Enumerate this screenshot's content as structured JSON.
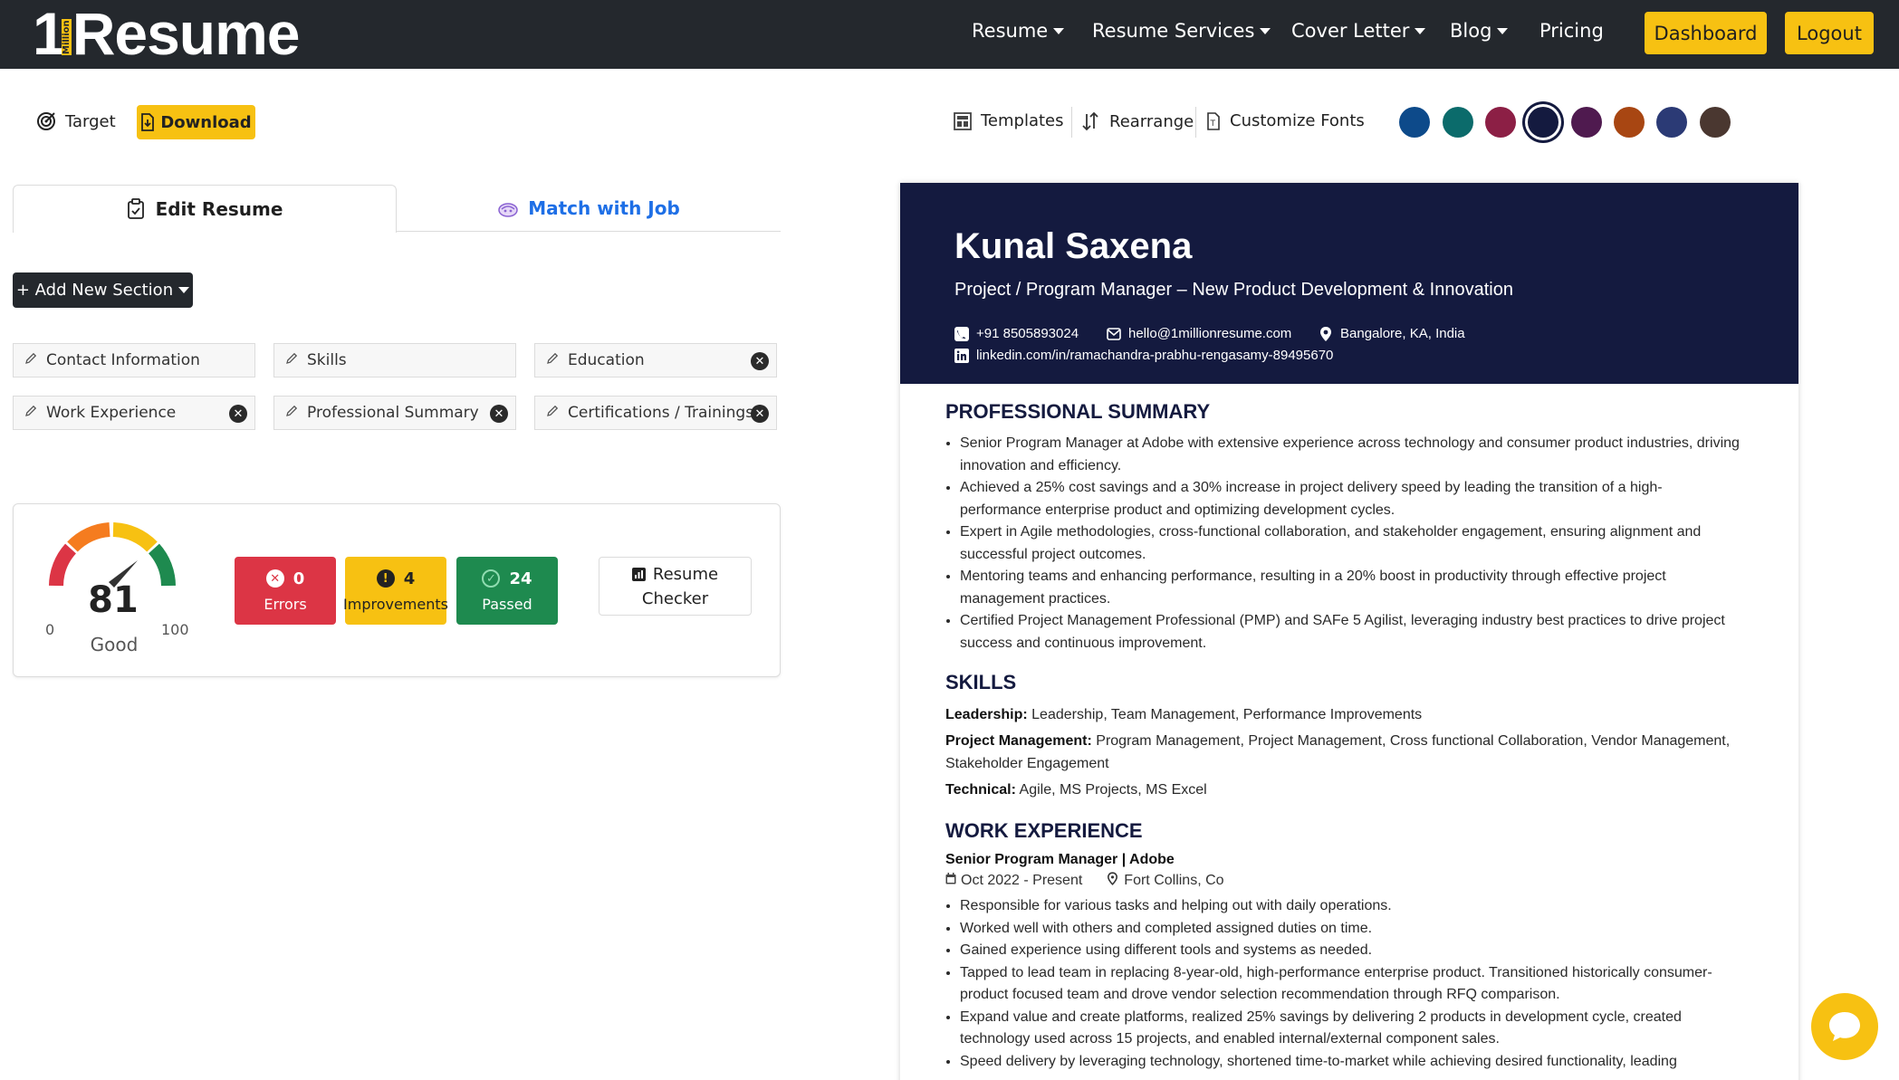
{
  "brand": {
    "logo_prefix": "1",
    "logo_million": "Million",
    "logo_name": "Resume"
  },
  "nav": {
    "resume": "Resume",
    "resume_services": "Resume Services",
    "cover_letter": "Cover Letter",
    "blog": "Blog",
    "pricing": "Pricing",
    "dashboard": "Dashboard",
    "logout": "Logout"
  },
  "toolbar": {
    "target": "Target",
    "download": "Download",
    "templates": "Templates",
    "rearrange": "Rearrange",
    "customize_fonts": "Customize Fonts",
    "colors": [
      "#0d4a8a",
      "#0b6b6b",
      "#8c1f45",
      "#141a3f",
      "#4f1a4f",
      "#a84612",
      "#2b3a75",
      "#4a3730"
    ],
    "selected_color": "#141a3f"
  },
  "tabs": {
    "edit_resume": "Edit Resume",
    "match_with_job": "Match with Job"
  },
  "add_section": "+ Add New Section",
  "sections": [
    {
      "label": "Contact Information",
      "removable": false
    },
    {
      "label": "Skills",
      "removable": false
    },
    {
      "label": "Education",
      "removable": true
    },
    {
      "label": "Work Experience",
      "removable": true
    },
    {
      "label": "Professional Summary",
      "removable": true
    },
    {
      "label": "Certifications / Trainings",
      "removable": true
    }
  ],
  "score": {
    "value": "81",
    "min": "0",
    "max": "100",
    "label": "Good",
    "errors_count": "0",
    "errors_label": "Errors",
    "improvements_count": "4",
    "improvements_label": "Improvements",
    "passed_count": "24",
    "passed_label": "Passed",
    "checker_line1": "Resume",
    "checker_line2": "Checker"
  },
  "resume": {
    "name": "Kunal Saxena",
    "title": "Project / Program Manager – New Product Development & Innovation",
    "phone": "+91 8505893024",
    "email": "hello@1millionresume.com",
    "location": "Bangalore, KA, India",
    "linkedin": "linkedin.com/in/ramachandra-prabhu-rengasamy-89495670",
    "summary_heading": "PROFESSIONAL SUMMARY",
    "summary": [
      "Senior Program Manager at Adobe with extensive experience across technology and consumer product industries, driving innovation and efficiency.",
      "Achieved a 25% cost savings and a 30% increase in project delivery speed by leading the transition of a high-performance enterprise product and optimizing development cycles.",
      "Expert in Agile methodologies, cross-functional collaboration, and stakeholder engagement, ensuring alignment and successful project outcomes.",
      "Mentoring teams and enhancing performance, resulting in a 20% boost in productivity through effective project management practices.",
      "Certified Project Management Professional (PMP) and SAFe 5 Agilist, leveraging industry best practices to drive project success and continuous improvement."
    ],
    "skills_heading": "SKILLS",
    "skills": [
      {
        "label": "Leadership:",
        "value": "Leadership, Team Management, Performance Improvements"
      },
      {
        "label": "Project Management:",
        "value": "Program Management, Project Management, Cross functional Collaboration, Vendor Management, Stakeholder Engagement"
      },
      {
        "label": "Technical:",
        "value": "Agile, MS Projects, MS Excel"
      }
    ],
    "work_heading": "WORK EXPERIENCE",
    "job_title": "Senior Program Manager | Adobe",
    "job_dates": "Oct 2022 - Present",
    "job_location": "Fort Collins, Co",
    "job_bullets": [
      "Responsible for various tasks and helping out with daily operations.",
      "Worked well with others and completed assigned duties on time.",
      "Gained experience using different tools and systems as needed.",
      "Tapped to lead team in replacing 8-year-old, high-performance enterprise product. Transitioned historically consumer-product focused team and drove vendor selection recommendation through RFQ comparison.",
      "Expand value and create platforms, realized 25% savings by delivering 2 products in development cycle, created technology used across 15 projects, and enabled internal/external component sales.",
      "Speed delivery by leveraging technology, shortened time-to-market while achieving desired functionality, leading"
    ]
  }
}
